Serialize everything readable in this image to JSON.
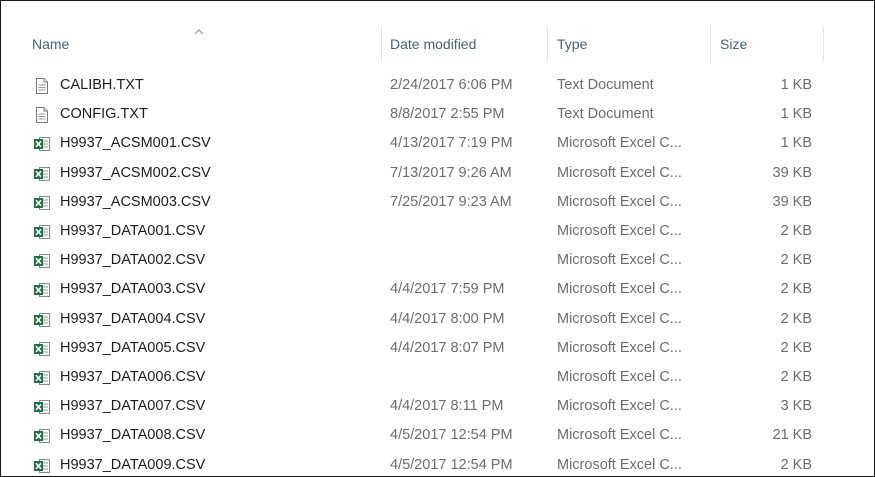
{
  "columns": {
    "name": "Name",
    "date": "Date modified",
    "type": "Type",
    "size": "Size"
  },
  "files": [
    {
      "name": "CALIBH.TXT",
      "date": "2/24/2017 6:06 PM",
      "type": "Text Document",
      "size": "1 KB",
      "icon": "text-file-icon"
    },
    {
      "name": "CONFIG.TXT",
      "date": "8/8/2017 2:55 PM",
      "type": "Text Document",
      "size": "1 KB",
      "icon": "text-file-icon"
    },
    {
      "name": "H9937_ACSM001.CSV",
      "date": "4/13/2017 7:19 PM",
      "type": "Microsoft Excel C...",
      "size": "1 KB",
      "icon": "excel-csv-icon"
    },
    {
      "name": "H9937_ACSM002.CSV",
      "date": "7/13/2017 9:26 AM",
      "type": "Microsoft Excel C...",
      "size": "39 KB",
      "icon": "excel-csv-icon"
    },
    {
      "name": "H9937_ACSM003.CSV",
      "date": "7/25/2017 9:23 AM",
      "type": "Microsoft Excel C...",
      "size": "39 KB",
      "icon": "excel-csv-icon"
    },
    {
      "name": "H9937_DATA001.CSV",
      "date": "",
      "type": "Microsoft Excel C...",
      "size": "2 KB",
      "icon": "excel-csv-icon"
    },
    {
      "name": "H9937_DATA002.CSV",
      "date": "",
      "type": "Microsoft Excel C...",
      "size": "2 KB",
      "icon": "excel-csv-icon"
    },
    {
      "name": "H9937_DATA003.CSV",
      "date": "4/4/2017 7:59 PM",
      "type": "Microsoft Excel C...",
      "size": "2 KB",
      "icon": "excel-csv-icon"
    },
    {
      "name": "H9937_DATA004.CSV",
      "date": "4/4/2017 8:00 PM",
      "type": "Microsoft Excel C...",
      "size": "2 KB",
      "icon": "excel-csv-icon"
    },
    {
      "name": "H9937_DATA005.CSV",
      "date": "4/4/2017 8:07 PM",
      "type": "Microsoft Excel C...",
      "size": "2 KB",
      "icon": "excel-csv-icon"
    },
    {
      "name": "H9937_DATA006.CSV",
      "date": "",
      "type": "Microsoft Excel C...",
      "size": "2 KB",
      "icon": "excel-csv-icon"
    },
    {
      "name": "H9937_DATA007.CSV",
      "date": "4/4/2017 8:11 PM",
      "type": "Microsoft Excel C...",
      "size": "3 KB",
      "icon": "excel-csv-icon"
    },
    {
      "name": "H9937_DATA008.CSV",
      "date": "4/5/2017 12:54 PM",
      "type": "Microsoft Excel C...",
      "size": "21 KB",
      "icon": "excel-csv-icon"
    },
    {
      "name": "H9937_DATA009.CSV",
      "date": "4/5/2017 12:54 PM",
      "type": "Microsoft Excel C...",
      "size": "2 KB",
      "icon": "excel-csv-icon"
    }
  ],
  "colors": {
    "header_text": "#4c607a",
    "secondary_text": "#6d6d6d",
    "excel_green": "#1d7044"
  }
}
